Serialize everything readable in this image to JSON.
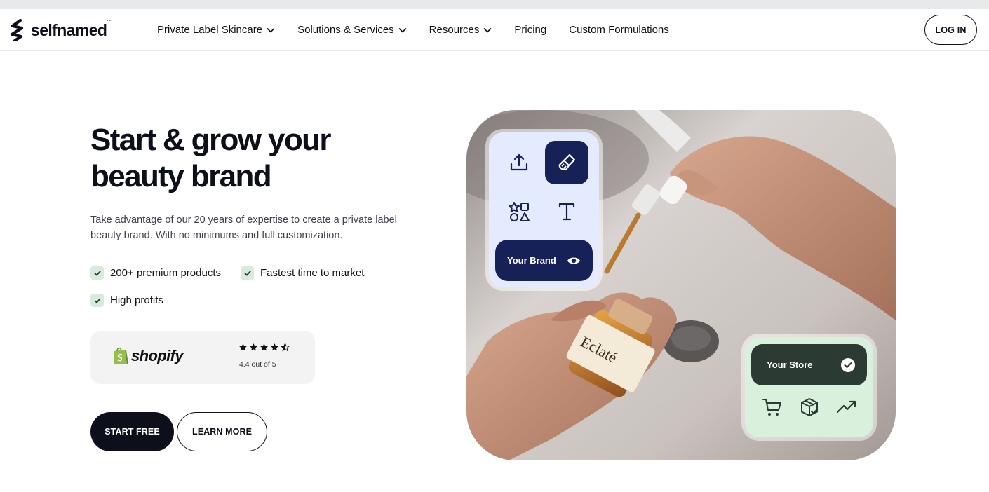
{
  "brand": {
    "name": "selfnamed",
    "tm": "™"
  },
  "nav": {
    "items": [
      {
        "label": "Private Label Skincare",
        "dropdown": true
      },
      {
        "label": "Solutions & Services",
        "dropdown": true
      },
      {
        "label": "Resources",
        "dropdown": true
      },
      {
        "label": "Pricing",
        "dropdown": false
      },
      {
        "label": "Custom Formulations",
        "dropdown": false
      }
    ],
    "login_label": "LOG IN"
  },
  "hero": {
    "title_line1": "Start & grow your",
    "title_line2": "beauty brand",
    "subtitle": "Take advantage of our 20 years of expertise to create a private label beauty brand. With no minimums and full customization.",
    "features": [
      "200+ premium products",
      "Fastest time to market",
      "High profits"
    ],
    "shopify": {
      "wordmark": "shopify",
      "rating_text": "4.4 out of 5",
      "stars": 4.5
    },
    "cta_primary": "START FREE",
    "cta_secondary": "LEARN MORE"
  },
  "visual": {
    "tools": [
      "upload-icon",
      "brush-icon",
      "shapes-icon",
      "text-icon"
    ],
    "brand_label": "Your Brand",
    "store_label": "Your Store",
    "store_icons": [
      "cart-icon",
      "package-icon",
      "trend-up-icon"
    ],
    "bottle_label": "Eclaté"
  },
  "colors": {
    "navy": "#162158",
    "dark": "#0d0f1a",
    "mint": "#d9f0dc",
    "forest": "#2b3b33",
    "shopify_green": "#95bf47"
  }
}
